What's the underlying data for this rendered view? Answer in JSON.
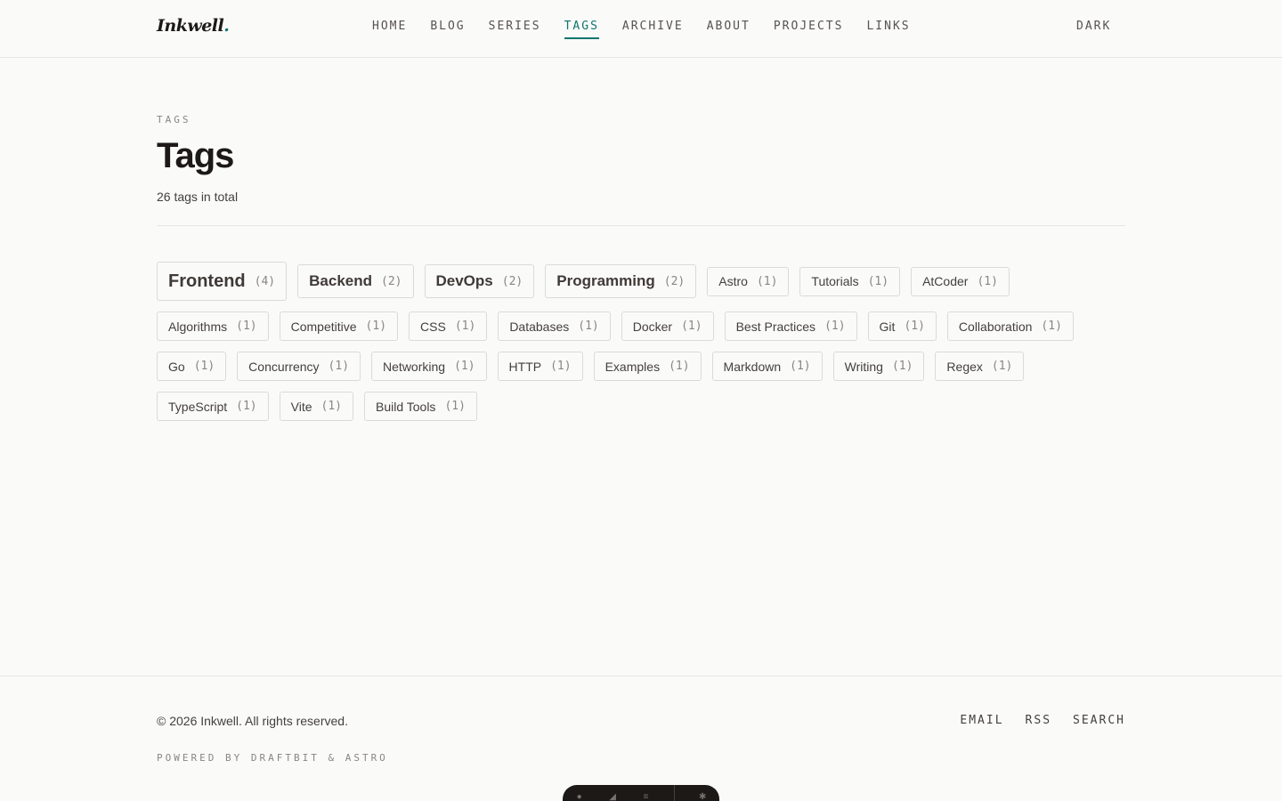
{
  "site": {
    "logo": "Inkwell",
    "logo_dot": "."
  },
  "nav": {
    "items": [
      "HOME",
      "BLOG",
      "SERIES",
      "TAGS",
      "ARCHIVE",
      "ABOUT",
      "PROJECTS",
      "LINKS"
    ],
    "active": "TAGS",
    "theme_toggle": "DARK"
  },
  "page": {
    "eyebrow": "TAGS",
    "title": "Tags",
    "subtitle": "26 tags in total"
  },
  "tags": [
    {
      "name": "Frontend",
      "count": "(4)",
      "size": "xl"
    },
    {
      "name": "Backend",
      "count": "(2)",
      "size": "lg"
    },
    {
      "name": "DevOps",
      "count": "(2)",
      "size": "lg"
    },
    {
      "name": "Programming",
      "count": "(2)",
      "size": "lg"
    },
    {
      "name": "Astro",
      "count": "(1)",
      "size": "md"
    },
    {
      "name": "Tutorials",
      "count": "(1)",
      "size": "md"
    },
    {
      "name": "AtCoder",
      "count": "(1)",
      "size": "md"
    },
    {
      "name": "Algorithms",
      "count": "(1)",
      "size": "md"
    },
    {
      "name": "Competitive",
      "count": "(1)",
      "size": "md"
    },
    {
      "name": "CSS",
      "count": "(1)",
      "size": "md"
    },
    {
      "name": "Databases",
      "count": "(1)",
      "size": "md"
    },
    {
      "name": "Docker",
      "count": "(1)",
      "size": "md"
    },
    {
      "name": "Best Practices",
      "count": "(1)",
      "size": "md"
    },
    {
      "name": "Git",
      "count": "(1)",
      "size": "md"
    },
    {
      "name": "Collaboration",
      "count": "(1)",
      "size": "md"
    },
    {
      "name": "Go",
      "count": "(1)",
      "size": "md"
    },
    {
      "name": "Concurrency",
      "count": "(1)",
      "size": "md"
    },
    {
      "name": "Networking",
      "count": "(1)",
      "size": "md"
    },
    {
      "name": "HTTP",
      "count": "(1)",
      "size": "md"
    },
    {
      "name": "Examples",
      "count": "(1)",
      "size": "md"
    },
    {
      "name": "Markdown",
      "count": "(1)",
      "size": "md"
    },
    {
      "name": "Writing",
      "count": "(1)",
      "size": "md"
    },
    {
      "name": "Regex",
      "count": "(1)",
      "size": "md"
    },
    {
      "name": "TypeScript",
      "count": "(1)",
      "size": "md"
    },
    {
      "name": "Vite",
      "count": "(1)",
      "size": "md"
    },
    {
      "name": "Build Tools",
      "count": "(1)",
      "size": "md"
    }
  ],
  "footer": {
    "copyright": "© 2026 Inkwell. All rights reserved.",
    "links": [
      "EMAIL",
      "RSS",
      "SEARCH"
    ],
    "powered": "POWERED BY DRAFTBIT & ASTRO"
  },
  "colors": {
    "accent": "#0f766e",
    "background": "#fafaf9",
    "text": "#1c1917"
  }
}
